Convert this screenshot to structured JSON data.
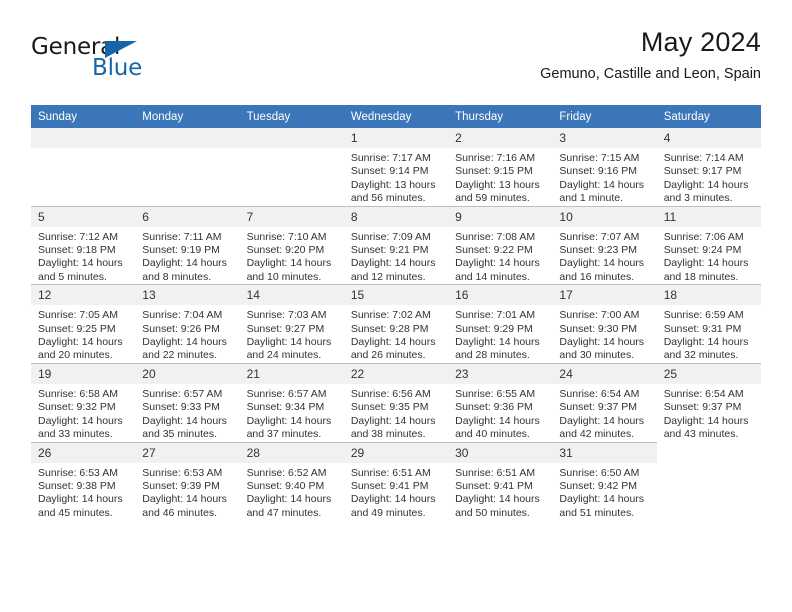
{
  "brand": {
    "word1": "General",
    "word2": "Blue",
    "accent_color": "#1565a8"
  },
  "header": {
    "title": "May 2024",
    "subtitle": "Gemuno, Castille and Leon, Spain"
  },
  "calendar": {
    "header_bg": "#3b76b8",
    "weekday_headers": [
      "Sunday",
      "Monday",
      "Tuesday",
      "Wednesday",
      "Thursday",
      "Friday",
      "Saturday"
    ],
    "weeks": [
      [
        {
          "day": "",
          "lines": []
        },
        {
          "day": "",
          "lines": []
        },
        {
          "day": "",
          "lines": []
        },
        {
          "day": "1",
          "lines": [
            "Sunrise: 7:17 AM",
            "Sunset: 9:14 PM",
            "Daylight: 13 hours",
            "and 56 minutes."
          ]
        },
        {
          "day": "2",
          "lines": [
            "Sunrise: 7:16 AM",
            "Sunset: 9:15 PM",
            "Daylight: 13 hours",
            "and 59 minutes."
          ]
        },
        {
          "day": "3",
          "lines": [
            "Sunrise: 7:15 AM",
            "Sunset: 9:16 PM",
            "Daylight: 14 hours",
            "and 1 minute."
          ]
        },
        {
          "day": "4",
          "lines": [
            "Sunrise: 7:14 AM",
            "Sunset: 9:17 PM",
            "Daylight: 14 hours",
            "and 3 minutes."
          ]
        }
      ],
      [
        {
          "day": "5",
          "lines": [
            "Sunrise: 7:12 AM",
            "Sunset: 9:18 PM",
            "Daylight: 14 hours",
            "and 5 minutes."
          ]
        },
        {
          "day": "6",
          "lines": [
            "Sunrise: 7:11 AM",
            "Sunset: 9:19 PM",
            "Daylight: 14 hours",
            "and 8 minutes."
          ]
        },
        {
          "day": "7",
          "lines": [
            "Sunrise: 7:10 AM",
            "Sunset: 9:20 PM",
            "Daylight: 14 hours",
            "and 10 minutes."
          ]
        },
        {
          "day": "8",
          "lines": [
            "Sunrise: 7:09 AM",
            "Sunset: 9:21 PM",
            "Daylight: 14 hours",
            "and 12 minutes."
          ]
        },
        {
          "day": "9",
          "lines": [
            "Sunrise: 7:08 AM",
            "Sunset: 9:22 PM",
            "Daylight: 14 hours",
            "and 14 minutes."
          ]
        },
        {
          "day": "10",
          "lines": [
            "Sunrise: 7:07 AM",
            "Sunset: 9:23 PM",
            "Daylight: 14 hours",
            "and 16 minutes."
          ]
        },
        {
          "day": "11",
          "lines": [
            "Sunrise: 7:06 AM",
            "Sunset: 9:24 PM",
            "Daylight: 14 hours",
            "and 18 minutes."
          ]
        }
      ],
      [
        {
          "day": "12",
          "lines": [
            "Sunrise: 7:05 AM",
            "Sunset: 9:25 PM",
            "Daylight: 14 hours",
            "and 20 minutes."
          ]
        },
        {
          "day": "13",
          "lines": [
            "Sunrise: 7:04 AM",
            "Sunset: 9:26 PM",
            "Daylight: 14 hours",
            "and 22 minutes."
          ]
        },
        {
          "day": "14",
          "lines": [
            "Sunrise: 7:03 AM",
            "Sunset: 9:27 PM",
            "Daylight: 14 hours",
            "and 24 minutes."
          ]
        },
        {
          "day": "15",
          "lines": [
            "Sunrise: 7:02 AM",
            "Sunset: 9:28 PM",
            "Daylight: 14 hours",
            "and 26 minutes."
          ]
        },
        {
          "day": "16",
          "lines": [
            "Sunrise: 7:01 AM",
            "Sunset: 9:29 PM",
            "Daylight: 14 hours",
            "and 28 minutes."
          ]
        },
        {
          "day": "17",
          "lines": [
            "Sunrise: 7:00 AM",
            "Sunset: 9:30 PM",
            "Daylight: 14 hours",
            "and 30 minutes."
          ]
        },
        {
          "day": "18",
          "lines": [
            "Sunrise: 6:59 AM",
            "Sunset: 9:31 PM",
            "Daylight: 14 hours",
            "and 32 minutes."
          ]
        }
      ],
      [
        {
          "day": "19",
          "lines": [
            "Sunrise: 6:58 AM",
            "Sunset: 9:32 PM",
            "Daylight: 14 hours",
            "and 33 minutes."
          ]
        },
        {
          "day": "20",
          "lines": [
            "Sunrise: 6:57 AM",
            "Sunset: 9:33 PM",
            "Daylight: 14 hours",
            "and 35 minutes."
          ]
        },
        {
          "day": "21",
          "lines": [
            "Sunrise: 6:57 AM",
            "Sunset: 9:34 PM",
            "Daylight: 14 hours",
            "and 37 minutes."
          ]
        },
        {
          "day": "22",
          "lines": [
            "Sunrise: 6:56 AM",
            "Sunset: 9:35 PM",
            "Daylight: 14 hours",
            "and 38 minutes."
          ]
        },
        {
          "day": "23",
          "lines": [
            "Sunrise: 6:55 AM",
            "Sunset: 9:36 PM",
            "Daylight: 14 hours",
            "and 40 minutes."
          ]
        },
        {
          "day": "24",
          "lines": [
            "Sunrise: 6:54 AM",
            "Sunset: 9:37 PM",
            "Daylight: 14 hours",
            "and 42 minutes."
          ]
        },
        {
          "day": "25",
          "lines": [
            "Sunrise: 6:54 AM",
            "Sunset: 9:37 PM",
            "Daylight: 14 hours",
            "and 43 minutes."
          ]
        }
      ],
      [
        {
          "day": "26",
          "lines": [
            "Sunrise: 6:53 AM",
            "Sunset: 9:38 PM",
            "Daylight: 14 hours",
            "and 45 minutes."
          ]
        },
        {
          "day": "27",
          "lines": [
            "Sunrise: 6:53 AM",
            "Sunset: 9:39 PM",
            "Daylight: 14 hours",
            "and 46 minutes."
          ]
        },
        {
          "day": "28",
          "lines": [
            "Sunrise: 6:52 AM",
            "Sunset: 9:40 PM",
            "Daylight: 14 hours",
            "and 47 minutes."
          ]
        },
        {
          "day": "29",
          "lines": [
            "Sunrise: 6:51 AM",
            "Sunset: 9:41 PM",
            "Daylight: 14 hours",
            "and 49 minutes."
          ]
        },
        {
          "day": "30",
          "lines": [
            "Sunrise: 6:51 AM",
            "Sunset: 9:41 PM",
            "Daylight: 14 hours",
            "and 50 minutes."
          ]
        },
        {
          "day": "31",
          "lines": [
            "Sunrise: 6:50 AM",
            "Sunset: 9:42 PM",
            "Daylight: 14 hours",
            "and 51 minutes."
          ]
        }
      ]
    ]
  }
}
